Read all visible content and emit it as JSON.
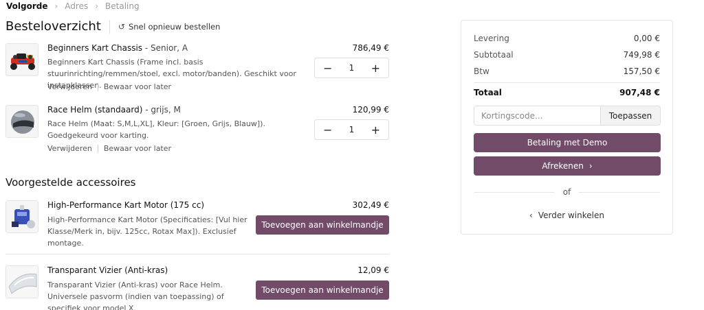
{
  "breadcrumb": {
    "step1": "Volgorde",
    "step2": "Adres",
    "step3": "Betaling"
  },
  "header": {
    "title": "Besteloverzicht",
    "reorder_label": "Snel opnieuw bestellen"
  },
  "cart": {
    "items": [
      {
        "name": "Beginners Kart Chassis",
        "variant": " - Senior, A",
        "price": "786,49 €",
        "description": "Beginners Kart Chassis (Frame incl. basis stuurinrichting/remmen/stoel, excl. motor/banden). Geschikt voor instapklassen.",
        "quantity": "1",
        "remove_label": "Verwijderen",
        "save_label": "Bewaar voor later"
      },
      {
        "name": "Race Helm (standaard)",
        "variant": " - grijs, M",
        "price": "120,99 €",
        "description": "Race Helm (Maat: S,M,L,XL], Kleur: [Groen, Grijs, Blauw]). Goedgekeurd voor karting.",
        "quantity": "1",
        "remove_label": "Verwijderen",
        "save_label": "Bewaar voor later"
      }
    ],
    "minus_symbol": "−",
    "plus_symbol": "+"
  },
  "accessories": {
    "title": "Voorgestelde accessoires",
    "items": [
      {
        "name": "High-Performance Kart Motor (175 cc)",
        "price": "302,49 €",
        "description": "High-Performance Kart Motor (Specificaties: [Vul hier Klasse/Merk in, bijv. 125cc, Rotax Max]). Exclusief montage.",
        "button": "Toevoegen aan winkelmandje"
      },
      {
        "name": "Transparant Vizier (Anti-kras)",
        "price": "12,09 €",
        "description": "Transparant Vizier (Anti-kras) voor Race Helm. Universele pasvorm (indien van toepassing) of specifiek voor model X.",
        "button": "Toevoegen aan winkelmandje"
      }
    ]
  },
  "summary": {
    "delivery_label": "Levering",
    "delivery_value": "0,00 €",
    "subtotal_label": "Subtotaal",
    "subtotal_value": "749,98 €",
    "tax_label": "Btw",
    "tax_value": "157,50 €",
    "total_label": "Totaal",
    "total_value": "907,48 €",
    "coupon_placeholder": "Kortingscode...",
    "apply_label": "Toepassen",
    "demo_pay_label": "Betaling met Demo",
    "checkout_label": "Afrekenen",
    "or_label": "of",
    "continue_label": "Verder winkelen"
  },
  "colors": {
    "accent": "#714b67"
  },
  "icons": {
    "breadcrumb_separator": "chevron-right-icon",
    "reorder": "rotate-ccw-icon",
    "checkout_arrow": "chevron-right-icon",
    "continue_arrow": "chevron-left-icon"
  }
}
